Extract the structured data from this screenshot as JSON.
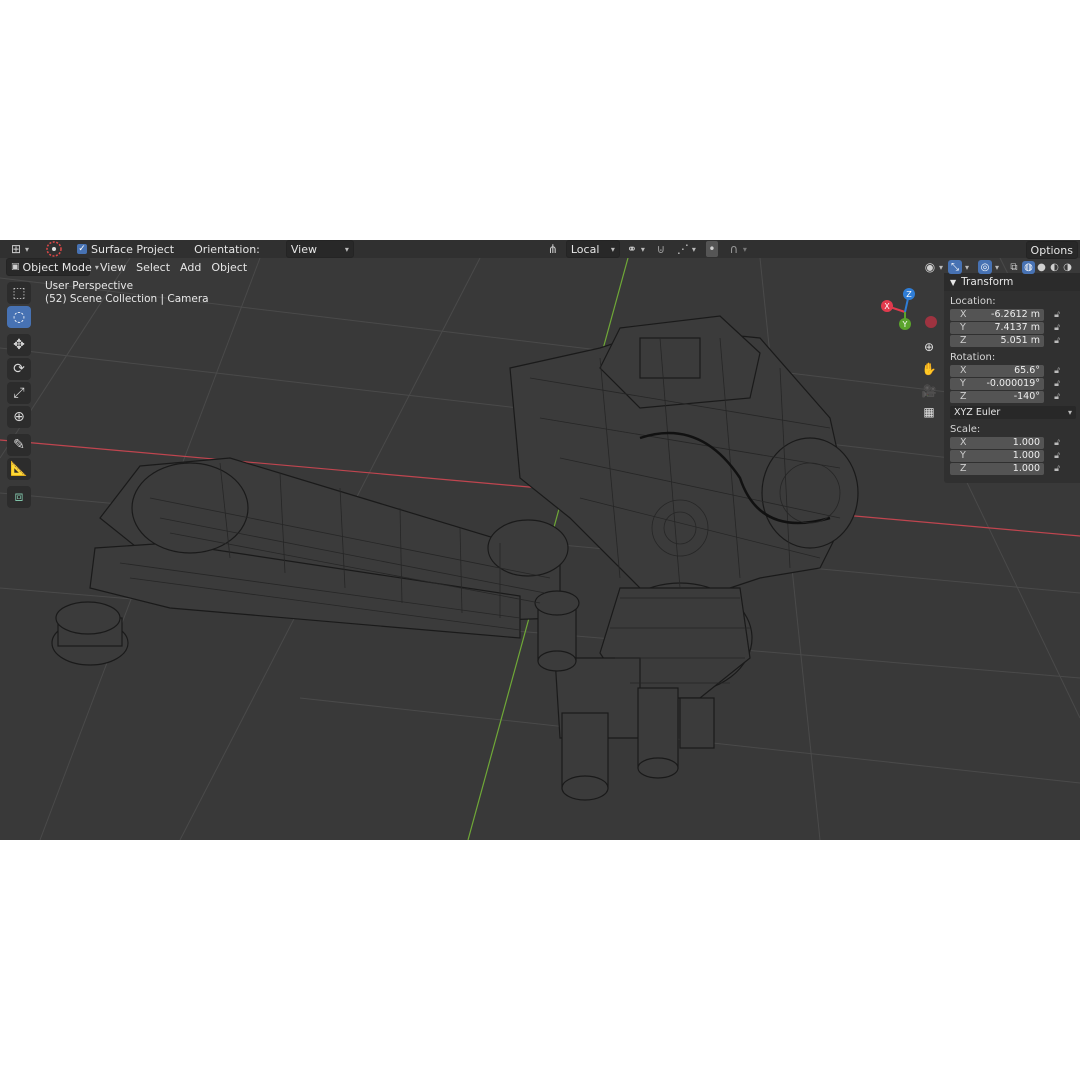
{
  "header": {
    "snap_target": "Surface Project",
    "orientation_label": "Orientation:",
    "orientation_value": "View",
    "pivot_value": "Local",
    "options_label": "Options"
  },
  "menu": {
    "mode": "Object Mode",
    "items": [
      "View",
      "Select",
      "Add",
      "Object"
    ]
  },
  "overlay": {
    "line1": "User Perspective",
    "line2": "(52) Scene Collection | Camera"
  },
  "gizmo": {
    "x_label": "X",
    "y_label": "Y",
    "z_label": "Z",
    "x_color": "#e03a4d",
    "y_color": "#5aa32b",
    "z_color": "#2f7dd6"
  },
  "transform_panel": {
    "title": "Transform",
    "location_label": "Location:",
    "location": [
      {
        "axis": "X",
        "value": "-6.2612 m"
      },
      {
        "axis": "Y",
        "value": "7.4137 m"
      },
      {
        "axis": "Z",
        "value": "5.051 m"
      }
    ],
    "rotation_label": "Rotation:",
    "rotation": [
      {
        "axis": "X",
        "value": "65.6°"
      },
      {
        "axis": "Y",
        "value": "-0.000019°"
      },
      {
        "axis": "Z",
        "value": "-140°"
      }
    ],
    "rotation_mode": "XYZ Euler",
    "scale_label": "Scale:",
    "scale": [
      {
        "axis": "X",
        "value": "1.000"
      },
      {
        "axis": "Y",
        "value": "1.000"
      },
      {
        "axis": "Z",
        "value": "1.000"
      }
    ]
  },
  "colors": {
    "accent": "#4772b3",
    "viewport_bg": "#393939",
    "x_axis_line": "#c0454f",
    "y_axis_line": "#6fa837"
  }
}
